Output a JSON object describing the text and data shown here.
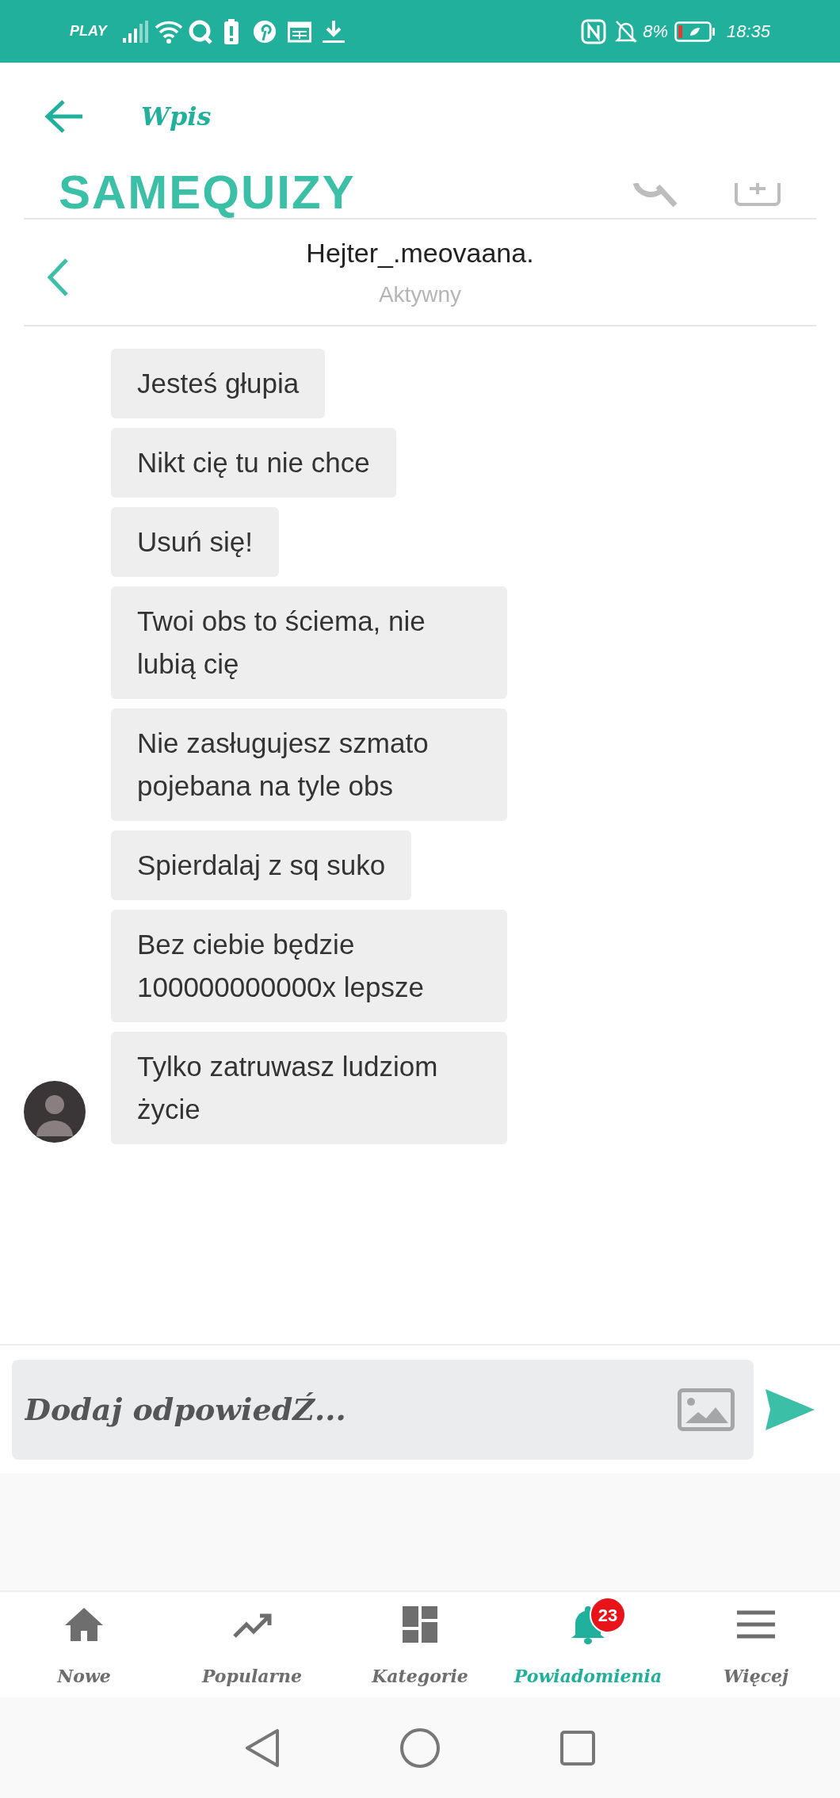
{
  "status_bar": {
    "carrier": "PLAY",
    "battery": "8%",
    "time": "18:35"
  },
  "app_bar": {
    "title": "Wpis"
  },
  "site_header": {
    "logo": "SAMEQUIZY"
  },
  "chat": {
    "contact": "Hejter_.meovaana.",
    "presence": "Aktywny",
    "messages": [
      {
        "text": "Jesteś głupia"
      },
      {
        "text": "Nikt cię tu nie chce"
      },
      {
        "text": "Usuń się!"
      },
      {
        "text": "Twoi obs to ściema, nie lubią cię"
      },
      {
        "text": "Nie zasługujesz szmato pojebana na tyle obs"
      },
      {
        "text": "Spierdalaj z sq suko"
      },
      {
        "text": "Bez ciebie będzie 100000000000x lepsze"
      },
      {
        "text": "Tylko zatruwasz ludziom życie"
      }
    ]
  },
  "composer": {
    "placeholder": "Dodaj odpowiedŹ..."
  },
  "bottom_nav": [
    {
      "kind": "home",
      "label": "Nowe",
      "selected": false
    },
    {
      "kind": "trend",
      "label": "Popularne",
      "selected": false
    },
    {
      "kind": "grid",
      "label": "Kategorie",
      "selected": false
    },
    {
      "kind": "bell",
      "label": "Powiadomienia",
      "selected": true,
      "badge": "23"
    },
    {
      "kind": "menu",
      "label": "Więcej",
      "selected": false
    }
  ]
}
